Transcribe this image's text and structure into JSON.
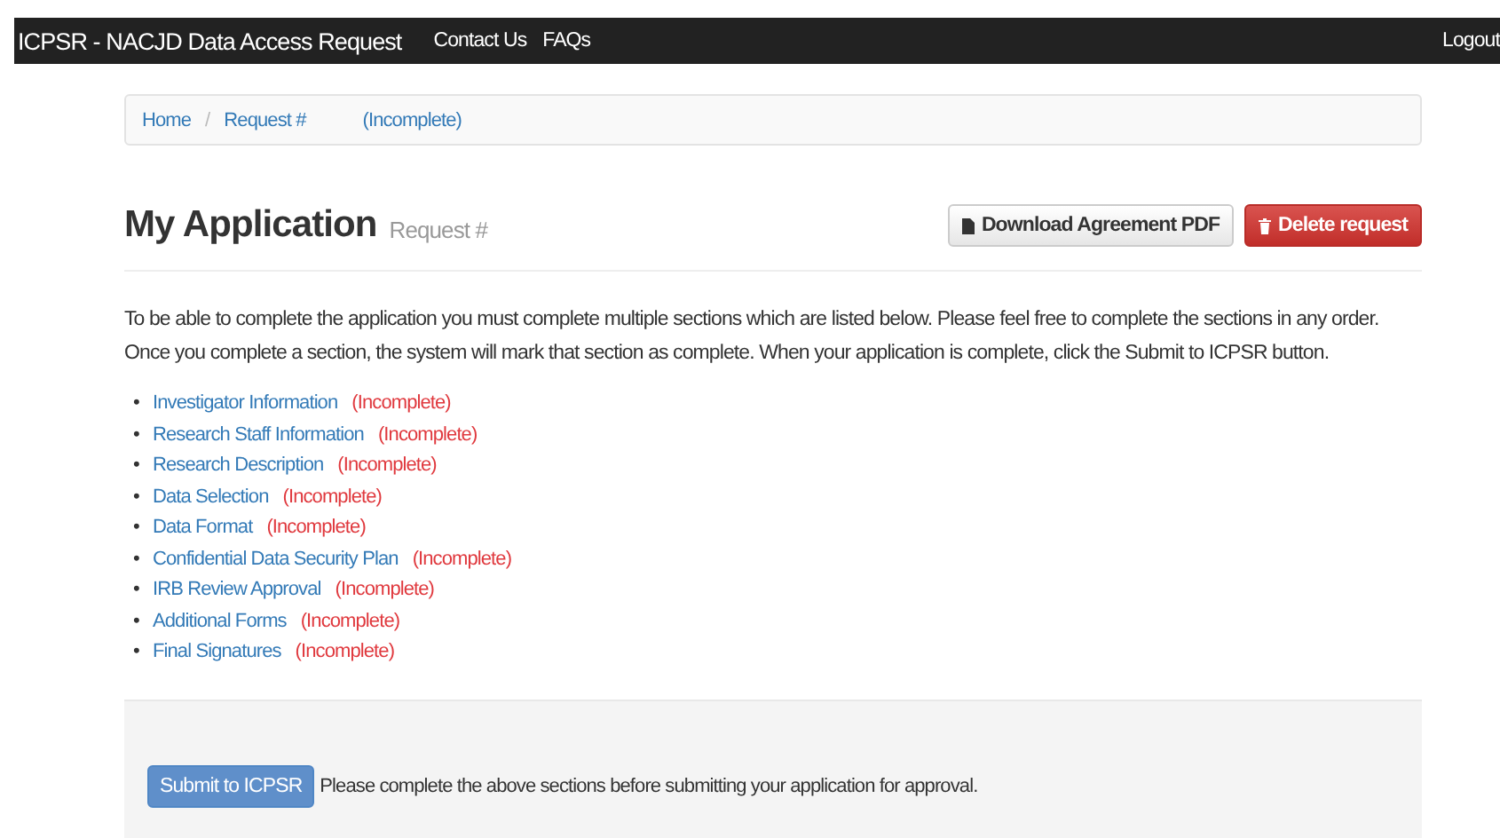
{
  "navbar": {
    "brand": "ICPSR - NACJD Data Access Request",
    "links": [
      "Contact Us",
      "FAQs"
    ],
    "logout": "Logout"
  },
  "breadcrumb": {
    "items": [
      "Home",
      "Request #"
    ],
    "separator": "/",
    "status": "(Incomplete)"
  },
  "header": {
    "title": "My Application",
    "subtitle": "Request #",
    "buttons": [
      {
        "label": "Download Agreement PDF",
        "kind": "default"
      },
      {
        "label": "Delete request",
        "kind": "danger"
      }
    ]
  },
  "intro": "To be able to complete the application you must complete multiple sections which are listed below. Please feel free to complete the sections in any order. Once you complete a section, the system will mark that section as complete. When your application is complete, click the Submit to ICPSR button.",
  "sections": [
    {
      "marker": "•",
      "label": "Investigator Information",
      "status": "(Incomplete)"
    },
    {
      "marker": "•",
      "label": "Research Staff Information",
      "status": "(Incomplete)"
    },
    {
      "marker": "•",
      "label": "Research Description",
      "status": "(Incomplete)"
    },
    {
      "marker": "•",
      "label": "Data Selection",
      "status": "(Incomplete)"
    },
    {
      "marker": "•",
      "label": "Data Format",
      "status": "(Incomplete)"
    },
    {
      "marker": "•",
      "label": "Confidential Data Security Plan",
      "status": "(Incomplete)"
    },
    {
      "marker": "•",
      "label": "IRB Review Approval",
      "status": "(Incomplete)"
    },
    {
      "marker": "•",
      "label": "Additional Forms",
      "status": "(Incomplete)"
    },
    {
      "marker": "•",
      "label": "Final Signatures",
      "status": "(Incomplete)"
    }
  ],
  "submit": {
    "button": "Submit to ICPSR",
    "disabled": true,
    "note": "Please complete the above sections before submitting your application for approval."
  }
}
